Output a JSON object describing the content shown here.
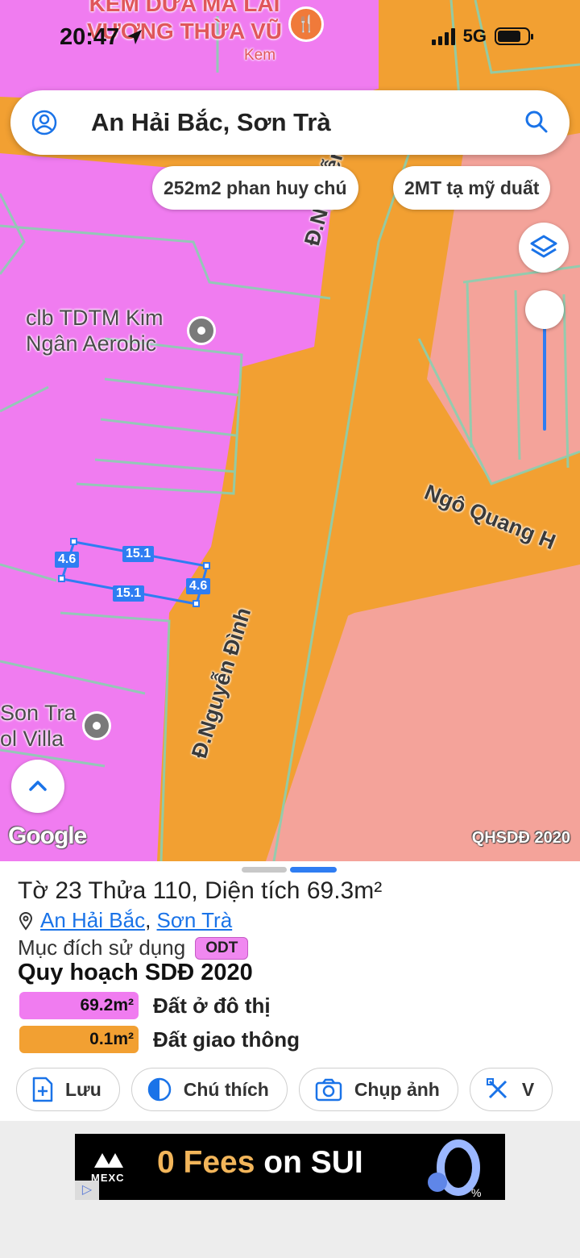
{
  "status": {
    "time": "20:47",
    "network": "5G"
  },
  "map": {
    "poi_top": "KEM DỪA MÃ LAI\nVƯƠNG THỪA VŨ",
    "poi_top_sub": "Kem",
    "poi_club": "clb TDTM Kim\nNgân Aerobic",
    "poi_villa": "Son Tra\nol Villa",
    "road_1": "Đ.Nguyễn Đình",
    "road_2": "Đ.Nguyễn Đình",
    "road_3": "Ngô Quang H",
    "dims": {
      "top": "15.1",
      "bottom": "15.1",
      "left": "4.6",
      "right": "4.6"
    },
    "attribution": "Google",
    "layer_label": "QHSDĐ 2020",
    "colors": {
      "residential": "#f07cf0",
      "transport": "#f2a032",
      "other": "#f4a39a",
      "parcel_line": "#8ad0b0"
    }
  },
  "search": {
    "query": "An Hải Bắc, Sơn Trà"
  },
  "chips": [
    "252m2 phan huy chú",
    "2MT tạ mỹ duất"
  ],
  "sheet": {
    "title": "Tờ 23 Thửa 110, Diện tích 69.3m²",
    "ward": "An Hải Bắc",
    "district": "Sơn Trà",
    "purpose_label": "Mục đích sử dụng",
    "purpose_code": "ODT",
    "plan_title": "Quy hoạch SDĐ 2020",
    "rows": [
      {
        "area": "69.2m²",
        "label": "Đất ở đô thị",
        "color": "#f07cf0"
      },
      {
        "area": "0.1m²",
        "label": "Đất giao thông",
        "color": "#f2a032"
      }
    ],
    "actions": {
      "save": "Lưu",
      "legend": "Chú thích",
      "photo": "Chụp ảnh",
      "more": "V"
    }
  },
  "ad": {
    "brand": "MEXC",
    "part1": "0 Fees",
    "part2": " on SUI"
  }
}
